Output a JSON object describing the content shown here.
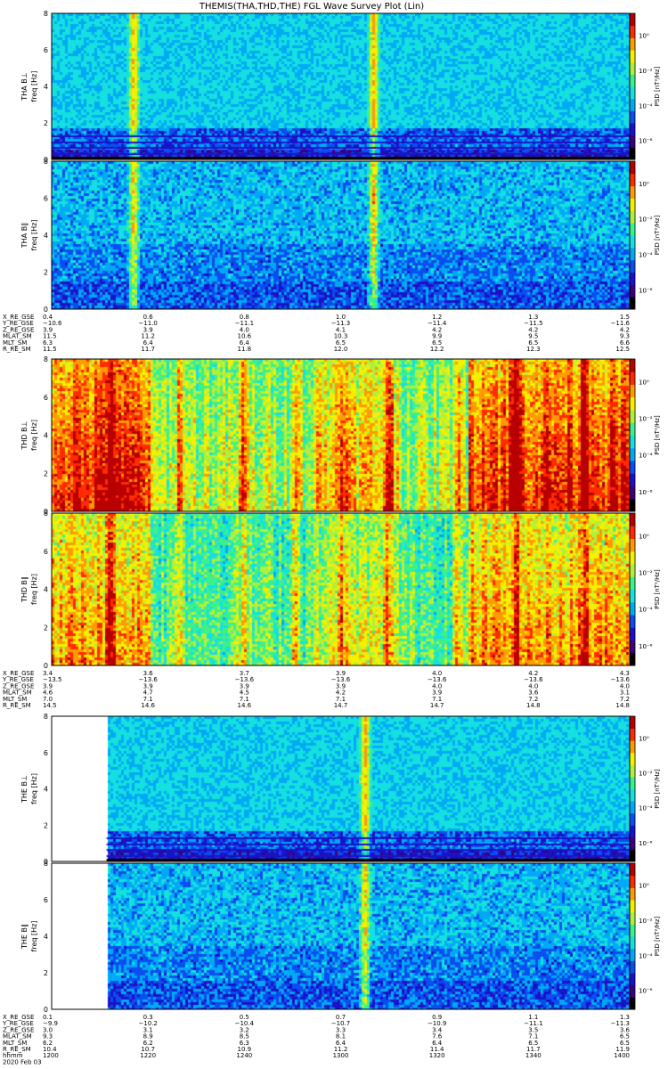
{
  "title": "THEMIS(THA,THD,THE) FGL Wave Survey Plot (Lin)",
  "colors": {
    "background": "#ffffff",
    "colormap": [
      "#000000",
      "#3b007a",
      "#1a12c8",
      "#0a4df0",
      "#00a9f5",
      "#14e0e0",
      "#3cf08c",
      "#b0f03c",
      "#f5f000",
      "#ff9a00",
      "#ff2a00",
      "#b80000"
    ]
  },
  "chart_data": [
    {
      "probe": "THA",
      "type": "heatmap",
      "panels": [
        {
          "ylabel_line1": "THA B⊥",
          "ylabel_line2": "freq [Hz]",
          "zlabel": "PSD [nT²/Hz]",
          "yticks": [
            "0",
            "2",
            "4",
            "6",
            "8"
          ],
          "ylim": [
            0,
            8
          ],
          "zticks": [
            "10⁰",
            "10⁻²",
            "10⁻⁴",
            "10⁻⁶"
          ],
          "style": "bperp_quiet"
        },
        {
          "ylabel_line1": "THA B∥",
          "ylabel_line2": "freq [Hz]",
          "zlabel": "PSD [nT²/Hz]",
          "yticks": [
            "0",
            "2",
            "4",
            "6",
            "8"
          ],
          "ylim": [
            0,
            8
          ],
          "zticks": [
            "10⁰",
            "10⁻²",
            "10⁻⁴",
            "10⁻⁶"
          ],
          "style": "bpar_quiet"
        }
      ],
      "events": [
        0.14,
        0.555
      ],
      "ephemeris": [
        {
          "label": "X_RE_GSE",
          "values": [
            "0.4",
            "0.6",
            "0.8",
            "1.0",
            "1.2",
            "1.3",
            "1.5"
          ]
        },
        {
          "label": "Y_RE_GSE",
          "values": [
            "−10.6",
            "−11.0",
            "−11.1",
            "−11.3",
            "−11.4",
            "−11.5",
            "−11.6"
          ]
        },
        {
          "label": "Z_RE_GSE",
          "values": [
            "3.9",
            "3.9",
            "4.0",
            "4.1",
            "4.2",
            "4.2",
            "4.2"
          ]
        },
        {
          "label": "MLAT_SM",
          "values": [
            "11.5",
            "11.2",
            "10.6",
            "10.3",
            "9.9",
            "9.5",
            "9.3"
          ]
        },
        {
          "label": "MLT_SM",
          "values": [
            "6.3",
            "6.4",
            "6.4",
            "6.5",
            "6.5",
            "6.5",
            "6.6"
          ]
        },
        {
          "label": "R_RE_SM",
          "values": [
            "11.5",
            "11.7",
            "11.8",
            "12.0",
            "12.2",
            "12.3",
            "12.5"
          ]
        }
      ]
    },
    {
      "probe": "THD",
      "type": "heatmap",
      "panels": [
        {
          "ylabel_line1": "THD B⊥",
          "ylabel_line2": "freq [Hz]",
          "zlabel": "PSD [nT²/Hz]",
          "yticks": [
            "0",
            "2",
            "4",
            "6",
            "8"
          ],
          "ylim": [
            0,
            8
          ],
          "zticks": [
            "10⁰",
            "10⁻²",
            "10⁻⁴",
            "10⁻⁶"
          ],
          "style": "bperp_active"
        },
        {
          "ylabel_line1": "THD B∥",
          "ylabel_line2": "freq [Hz]",
          "zlabel": "PSD [nT²/Hz]",
          "yticks": [
            "0",
            "2",
            "4",
            "6",
            "8"
          ],
          "ylim": [
            0,
            8
          ],
          "zticks": [
            "10⁰",
            "10⁻²",
            "10⁻⁴",
            "10⁻⁶"
          ],
          "style": "bpar_active"
        }
      ],
      "events": [
        0.1,
        0.22,
        0.33,
        0.42,
        0.5,
        0.58,
        0.7,
        0.8,
        0.92
      ],
      "ephemeris": [
        {
          "label": "X_RE_GSE",
          "values": [
            "3.4",
            "3.6",
            "3.7",
            "3.9",
            "4.0",
            "4.2",
            "4.3"
          ]
        },
        {
          "label": "Y_RE_GSE",
          "values": [
            "−13.5",
            "−13.6",
            "−13.6",
            "−13.6",
            "−13.6",
            "−13.6",
            "−13.6"
          ]
        },
        {
          "label": "Z_RE_GSE",
          "values": [
            "3.9",
            "3.9",
            "3.9",
            "3.9",
            "4.0",
            "4.0",
            "4.0"
          ]
        },
        {
          "label": "MLAT_SM",
          "values": [
            "4.6",
            "4.7",
            "4.5",
            "4.2",
            "3.9",
            "3.6",
            "3.1"
          ]
        },
        {
          "label": "MLT_SM",
          "values": [
            "7.0",
            "7.1",
            "7.1",
            "7.1",
            "7.1",
            "7.2",
            "7.2"
          ]
        },
        {
          "label": "R_RE_SM",
          "values": [
            "14.5",
            "14.6",
            "14.6",
            "14.7",
            "14.7",
            "14.8",
            "14.8"
          ]
        }
      ]
    },
    {
      "probe": "THE",
      "type": "heatmap",
      "panels": [
        {
          "ylabel_line1": "THE B⊥",
          "ylabel_line2": "freq [Hz]",
          "zlabel": "PSD [nT²/Hz]",
          "yticks": [
            "0",
            "2",
            "4",
            "6",
            "8"
          ],
          "ylim": [
            0,
            8
          ],
          "zticks": [
            "10⁰",
            "10⁻²",
            "10⁻⁴",
            "10⁻⁶"
          ],
          "style": "bperp_quiet"
        },
        {
          "ylabel_line1": "THE B∥",
          "ylabel_line2": "freq [Hz]",
          "zlabel": "PSD [nT²/Hz]",
          "yticks": [
            "0",
            "2",
            "4",
            "6",
            "8"
          ],
          "ylim": [
            0,
            8
          ],
          "zticks": [
            "10⁰",
            "10⁻²",
            "10⁻⁴",
            "10⁻⁶"
          ],
          "style": "bpar_quiet"
        }
      ],
      "data_gap_until": 0.095,
      "events": [
        0.54
      ],
      "ephemeris": [
        {
          "label": "X_RE_GSE",
          "values": [
            "0.1",
            "0.3",
            "0.5",
            "0.7",
            "0.9",
            "1.1",
            "1.3"
          ]
        },
        {
          "label": "Y_RE_GSE",
          "values": [
            "−9.9",
            "−10.2",
            "−10.4",
            "−10.7",
            "−10.9",
            "−11.1",
            "−11.3"
          ]
        },
        {
          "label": "Z_RE_GSE",
          "values": [
            "3.0",
            "3.1",
            "3.2",
            "3.3",
            "3.4",
            "3.5",
            "3.6"
          ]
        },
        {
          "label": "MLAT_SM",
          "values": [
            "9.3",
            "8.9",
            "8.5",
            "8.1",
            "7.6",
            "7.1",
            "6.5"
          ]
        },
        {
          "label": "MLT_SM",
          "values": [
            "6.2",
            "6.2",
            "6.3",
            "6.4",
            "6.4",
            "6.5",
            "6.5"
          ]
        },
        {
          "label": "R_RE_SM",
          "values": [
            "10.4",
            "10.7",
            "10.9",
            "11.2",
            "11.4",
            "11.7",
            "11.9"
          ]
        },
        {
          "label": "hhmm",
          "values": [
            "1200",
            "1220",
            "1240",
            "1300",
            "1320",
            "1340",
            "1400"
          ]
        }
      ],
      "date": "2020 Feb 03"
    }
  ]
}
